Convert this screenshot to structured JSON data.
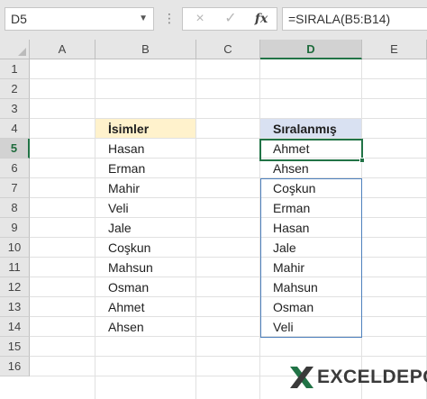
{
  "formula_bar": {
    "name_box": "D5",
    "cancel_icon": "×",
    "enter_icon": "✓",
    "fx_label": "fx",
    "formula": "=SIRALA(B5:B14)"
  },
  "columns": [
    "A",
    "B",
    "C",
    "D",
    "E"
  ],
  "selected_column": "D",
  "rows": [
    "1",
    "2",
    "3",
    "4",
    "5",
    "6",
    "7",
    "8",
    "9",
    "10",
    "11",
    "12",
    "13",
    "14",
    "15",
    "16"
  ],
  "selected_row": "5",
  "source": {
    "header": "İsimler",
    "values": [
      "Hasan",
      "Erman",
      "Mahir",
      "Veli",
      "Jale",
      "Coşkun",
      "Mahsun",
      "Osman",
      "Ahmet",
      "Ahsen"
    ]
  },
  "sorted": {
    "header": "Sıralanmış",
    "values": [
      "Ahmet",
      "Ahsen",
      "Coşkun",
      "Erman",
      "Hasan",
      "Jale",
      "Mahir",
      "Mahsun",
      "Osman",
      "Veli"
    ]
  },
  "logo": {
    "word1": "EXCEL",
    "word2": "DEPO"
  },
  "colors": {
    "accent_green": "#217346",
    "header_yellow": "#fff2cc",
    "header_blue": "#d9e1f2",
    "spill_border": "#4f81bd"
  }
}
